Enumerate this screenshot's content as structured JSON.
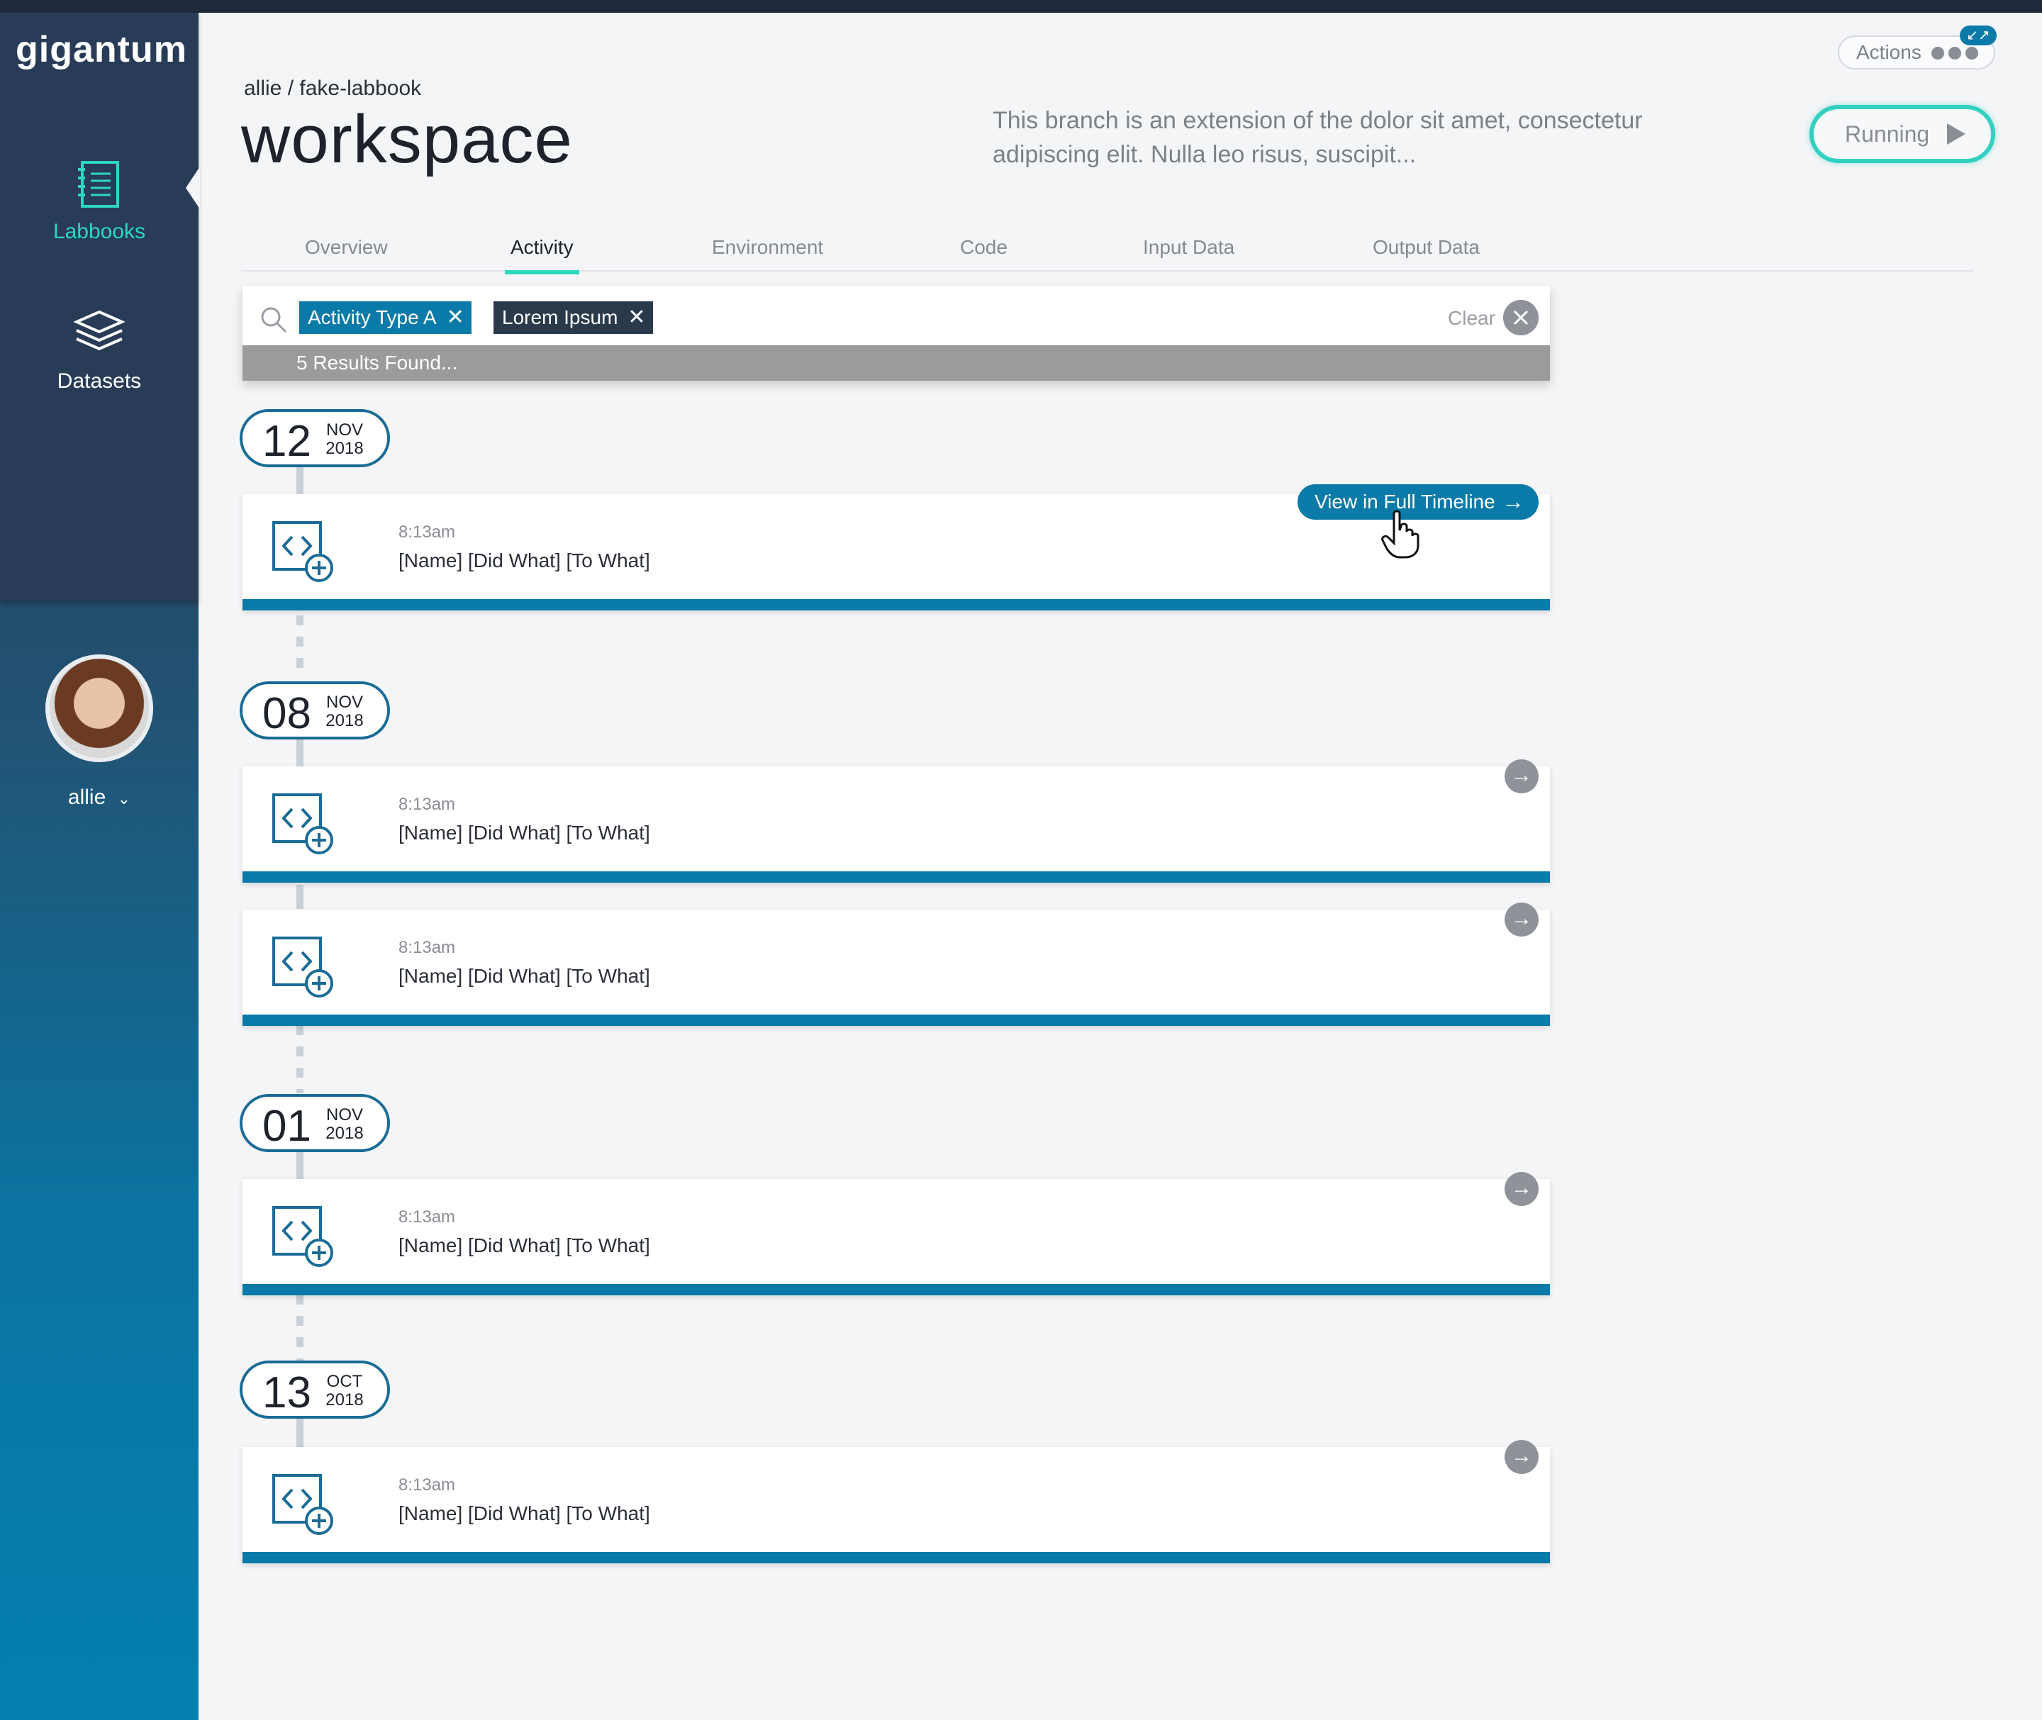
{
  "app": {
    "logo": "gigantum"
  },
  "sidebar": {
    "items": [
      {
        "label": "Labbooks",
        "icon": "notebook-icon",
        "active": true
      },
      {
        "label": "Datasets",
        "icon": "layers-icon",
        "active": false
      }
    ],
    "user": {
      "name": "allie"
    }
  },
  "header": {
    "breadcrumb": "allie / fake-labbook",
    "title": "workspace",
    "description": "This branch is an extension of the dolor sit amet, consectetur adipiscing elit. Nulla leo risus, suscipit...",
    "actions_label": "Actions",
    "status_label": "Running"
  },
  "tabs": [
    {
      "label": "Overview"
    },
    {
      "label": "Activity",
      "active": true
    },
    {
      "label": "Environment"
    },
    {
      "label": "Code"
    },
    {
      "label": "Input Data"
    },
    {
      "label": "Output Data"
    }
  ],
  "filter": {
    "chips": [
      {
        "label": "Activity Type A"
      },
      {
        "label": "Lorem Ipsum"
      }
    ],
    "clear_label": "Clear",
    "results": "5 Results Found..."
  },
  "timeline": {
    "view_button": "View in Full Timeline",
    "dates": [
      {
        "day": "12",
        "month": "NOV",
        "year": "2018"
      },
      {
        "day": "08",
        "month": "NOV",
        "year": "2018"
      },
      {
        "day": "01",
        "month": "NOV",
        "year": "2018"
      },
      {
        "day": "13",
        "month": "OCT",
        "year": "2018"
      }
    ],
    "entries": [
      {
        "time": "8:13am",
        "text": "[Name] [Did What] [To What]"
      },
      {
        "time": "8:13am",
        "text": "[Name] [Did What] [To What]"
      },
      {
        "time": "8:13am",
        "text": "[Name] [Did What] [To What]"
      },
      {
        "time": "8:13am",
        "text": "[Name] [Did What] [To What]"
      },
      {
        "time": "8:13am",
        "text": "[Name] [Did What] [To What]"
      }
    ]
  },
  "colors": {
    "accent": "#2dd7c0",
    "primary": "#0a7aa8",
    "sidebar": "#283c57"
  }
}
